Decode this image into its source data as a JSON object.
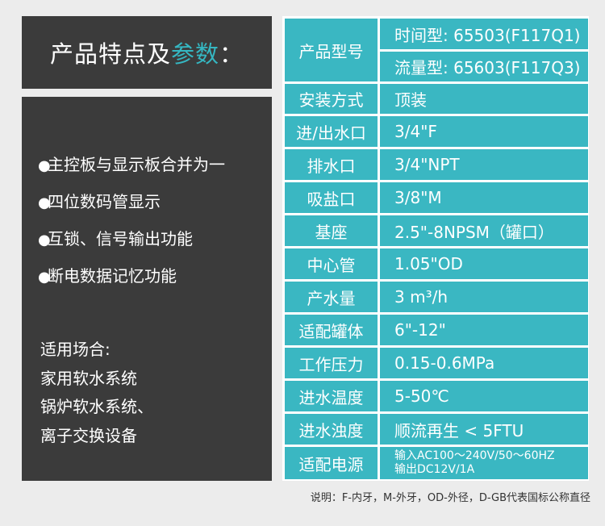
{
  "title": {
    "main": "产品特点及",
    "highlight": "参数",
    "colon": "："
  },
  "features": [
    "主控板与显示板合并为一",
    "四位数码管显示",
    "互锁、信号输出功能",
    "断电数据记忆功能"
  ],
  "bullet": "●",
  "applications": {
    "heading": "适用场合:",
    "lines": [
      "家用软水系统",
      "锅炉软水系统、",
      "离子交换设备"
    ]
  },
  "specs": {
    "model_label": "产品型号",
    "model_values": [
      "时间型: 65503(F117Q1)",
      "流量型: 65603(F117Q3)"
    ],
    "rows": [
      {
        "label": "安装方式",
        "value": "顶装"
      },
      {
        "label": "进/出水口",
        "value": "3/4\"F"
      },
      {
        "label": "排水口",
        "value": "3/4\"NPT"
      },
      {
        "label": "吸盐口",
        "value": "3/8\"M"
      },
      {
        "label": "基座",
        "value": "2.5\"-8NPSM（罐口）"
      },
      {
        "label": "中心管",
        "value": "1.05\"OD"
      },
      {
        "label": "产水量",
        "value": "3 m³/h"
      },
      {
        "label": "适配罐体",
        "value": "6\"-12\""
      },
      {
        "label": "工作压力",
        "value": "0.15-0.6MPa"
      },
      {
        "label": "进水温度",
        "value": "5-50℃"
      },
      {
        "label": "进水浊度",
        "value": "顺流再生 < 5FTU"
      }
    ],
    "power_label": "适配电源",
    "power_values": [
      "输入AC100～240V/50～60HZ",
      "输出DC12V/1A"
    ]
  },
  "note": "说明：F-内牙，M-外牙，OD-外径，D-GB代表国标公称直径",
  "colors": {
    "dark_panel": "#3b3b3b",
    "accent": "#3ab7c2",
    "background": "#ececec"
  }
}
